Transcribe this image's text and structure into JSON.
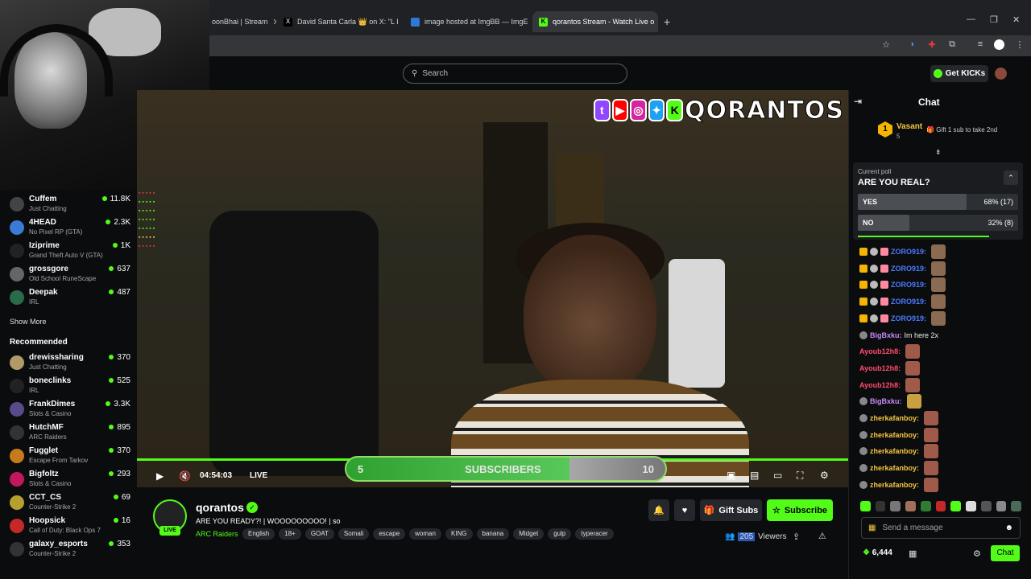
{
  "browser": {
    "tabs": [
      {
        "title": "oonBhai | Stream",
        "active": false
      },
      {
        "title": "David Santa Carla 👑 on X: \"L I",
        "active": false
      },
      {
        "title": "image hosted at ImgBB — ImgE",
        "active": false
      },
      {
        "title": "qorantos Stream - Watch Live o",
        "active": true
      }
    ],
    "new_tab": "+"
  },
  "header": {
    "search_placeholder": "Search",
    "get_kicks_label": "Get KICKs"
  },
  "sidebar": {
    "following": [
      {
        "name": "Cuffem",
        "category": "Just Chatting",
        "viewers": "11.8K",
        "color": "#444"
      },
      {
        "name": "4HEAD",
        "category": "No Pixel RP (GTA)",
        "viewers": "2.3K",
        "color": "#3a7bd5"
      },
      {
        "name": "Iziprime",
        "category": "Grand Theft Auto V (GTA)",
        "viewers": "1K",
        "color": "#222"
      },
      {
        "name": "grossgore",
        "category": "Old School RuneScape",
        "viewers": "637",
        "color": "#666"
      },
      {
        "name": "Deepak",
        "category": "IRL",
        "viewers": "487",
        "color": "#2a6b4a"
      }
    ],
    "show_more": "Show More",
    "recommended_label": "Recommended",
    "recommended": [
      {
        "name": "drewissharing",
        "category": "Just Chatting",
        "viewers": "370",
        "color": "#b09a6a"
      },
      {
        "name": "boneclinks",
        "category": "IRL",
        "viewers": "525",
        "color": "#222"
      },
      {
        "name": "FrankDimes",
        "category": "Slots & Casino",
        "viewers": "3.3K",
        "color": "#5a4a8a"
      },
      {
        "name": "HutchMF",
        "category": "ARC Raiders",
        "viewers": "895",
        "color": "#333"
      },
      {
        "name": "Fugglet",
        "category": "Escape From Tarkov",
        "viewers": "370",
        "color": "#c77a1a"
      },
      {
        "name": "Bigfoltz",
        "category": "Slots & Casino",
        "viewers": "293",
        "color": "#c2185b"
      },
      {
        "name": "CCT_CS",
        "category": "Counter-Strike 2",
        "viewers": "69",
        "color": "#b8a030"
      },
      {
        "name": "Hoopsick",
        "category": "Call of Duty: Black Ops 7",
        "viewers": "16",
        "color": "#c62828"
      },
      {
        "name": "galaxy_esports",
        "category": "Counter-Strike 2",
        "viewers": "353",
        "color": "#333"
      }
    ]
  },
  "video": {
    "overlay_name": "QORANTOS",
    "sub_goal_start": "5",
    "sub_goal_label": "SUBSCRIBERS",
    "sub_goal_end": "10",
    "sub_goal_progress": 0.7,
    "time": "04:54:03",
    "live_label": "LIVE"
  },
  "channel": {
    "name": "qorantos",
    "live_badge": "LIVE",
    "title": "ARE YOU READY?! | WOOOOOOOOO! | so",
    "category": "ARC Raiders",
    "tags": [
      "English",
      "18+",
      "GOAT",
      "Somali",
      "escape",
      "woman",
      "KING",
      "banana",
      "Midget",
      "gulp",
      "typeracer"
    ],
    "gift_subs_label": "Gift Subs",
    "subscribe_label": "Subscribe",
    "viewers_count": "205",
    "viewers_suffix": "Viewers"
  },
  "chat": {
    "title": "Chat",
    "pinned": {
      "rank": "1",
      "user": "Vasant",
      "count": "5",
      "message": "Gift 1 sub to take 2nd"
    },
    "poll": {
      "label": "Current poll",
      "question": "ARE YOU REAL?",
      "options": [
        {
          "label": "YES",
          "result": "68% (17)",
          "fraction": 0.68
        },
        {
          "label": "NO",
          "result": "32% (8)",
          "fraction": 0.32
        }
      ],
      "timer_fraction": 0.82
    },
    "messages": [
      {
        "user": "ZORO919:",
        "text": "",
        "color": "#4b7bff"
      },
      {
        "user": "ZORO919:",
        "text": "",
        "color": "#4b7bff"
      },
      {
        "user": "ZORO919:",
        "text": "",
        "color": "#4b7bff"
      },
      {
        "user": "ZORO919:",
        "text": "",
        "color": "#4b7bff"
      },
      {
        "user": "ZORO919:",
        "text": "",
        "color": "#4b7bff"
      },
      {
        "user": "BigBxku:",
        "text": "Im here 2x",
        "color": "#c58af9"
      },
      {
        "user": "Ayoub12h8:",
        "text": "",
        "color": "#ff4d6d"
      },
      {
        "user": "Ayoub12h8:",
        "text": "",
        "color": "#ff4d6d"
      },
      {
        "user": "Ayoub12h8:",
        "text": "",
        "color": "#ff4d6d"
      },
      {
        "user": "BigBxku:",
        "text": "",
        "color": "#c58af9"
      },
      {
        "user": "zherkafanboy:",
        "text": "",
        "color": "#f5c542"
      },
      {
        "user": "zherkafanboy:",
        "text": "",
        "color": "#f5c542"
      },
      {
        "user": "zherkafanboy:",
        "text": "",
        "color": "#f5c542"
      },
      {
        "user": "zherkafanboy:",
        "text": "",
        "color": "#f5c542"
      },
      {
        "user": "zherkafanboy:",
        "text": "",
        "color": "#f5c542"
      }
    ],
    "input_placeholder": "Send a message",
    "points": "6,444",
    "chat_button": "Chat"
  },
  "colors": {
    "brand": "#53fc18",
    "bg": "#0b0c0e"
  }
}
